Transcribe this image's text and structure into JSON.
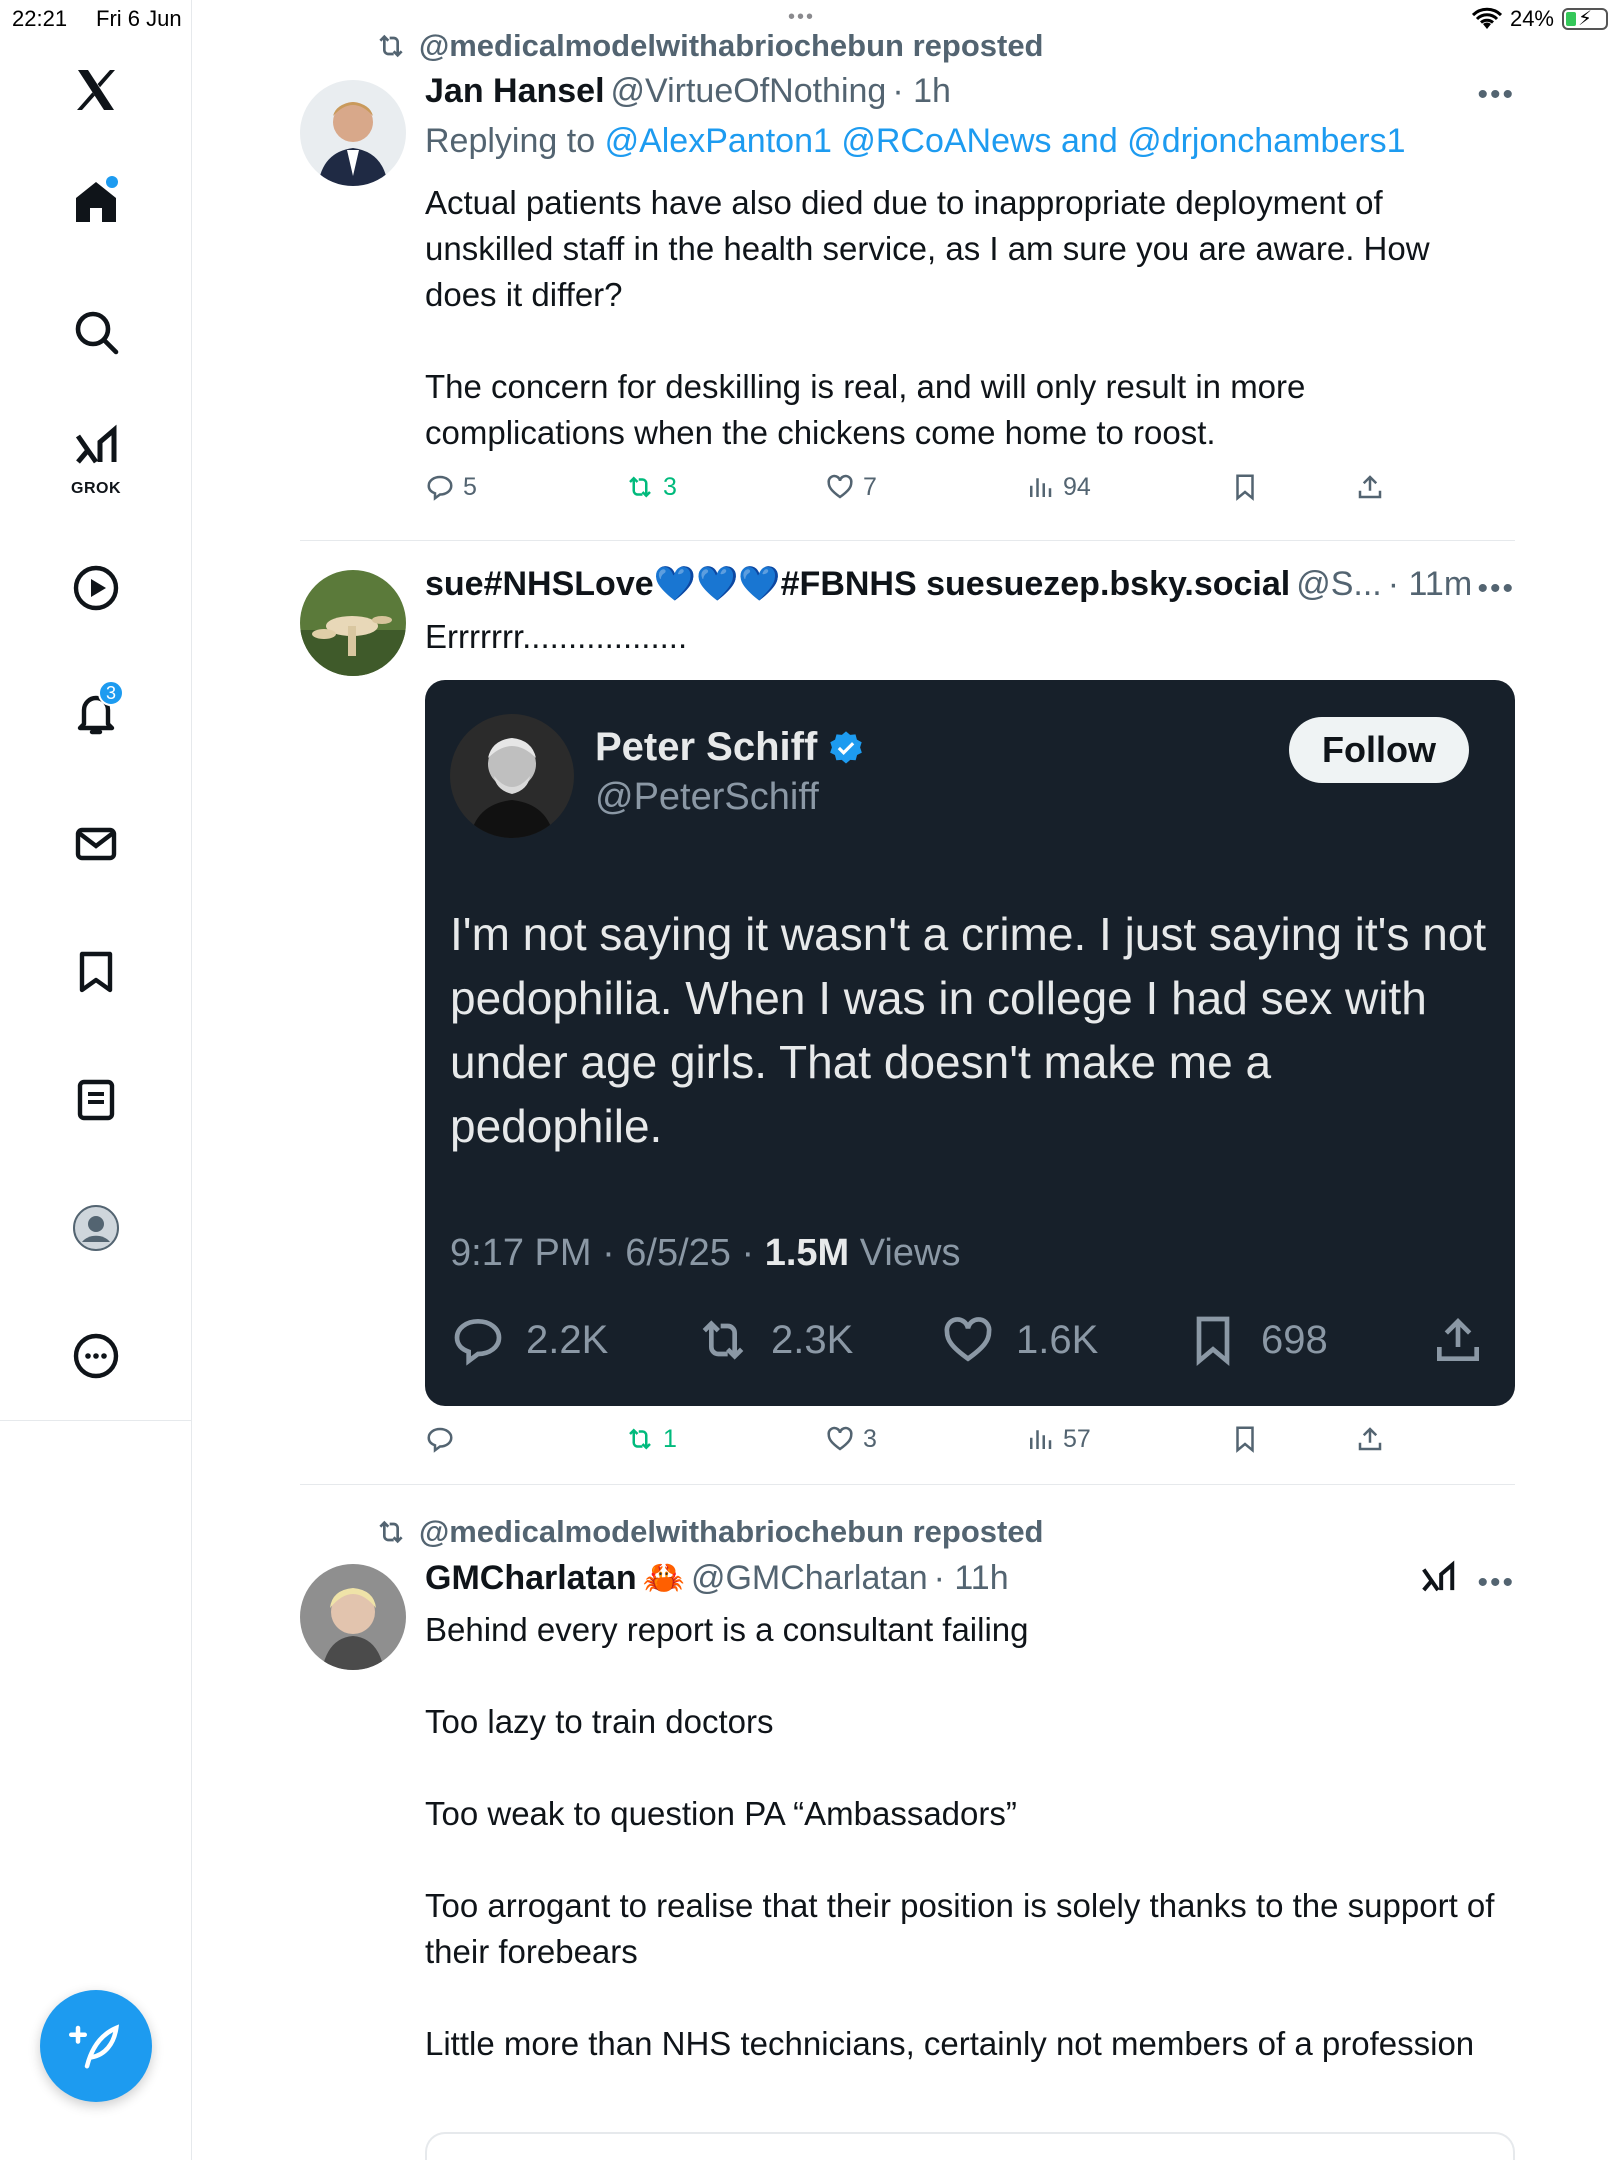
{
  "status_bar": {
    "time": "22:21",
    "date": "Fri 6 Jun",
    "battery": "24%",
    "top_dots": "•••"
  },
  "sidebar": {
    "items": [
      {
        "name": "home",
        "has_dot": true
      },
      {
        "name": "explore"
      },
      {
        "name": "grok",
        "label": "GROK"
      },
      {
        "name": "video"
      },
      {
        "name": "notifications",
        "badge": "3"
      },
      {
        "name": "messages"
      },
      {
        "name": "bookmarks"
      },
      {
        "name": "lists"
      },
      {
        "name": "profile"
      },
      {
        "name": "more"
      }
    ]
  },
  "colors": {
    "accent": "#1d9bf0",
    "repost_green": "#00ba7c",
    "muted": "#536471",
    "embed_bg": "#17202a"
  },
  "posts": [
    {
      "repost_by": "@medicalmodelwithabriochebun reposted",
      "name": "Jan Hansel",
      "handle": "@VirtueOfNothing",
      "time": "· 1h",
      "replying_prefix": "Replying to",
      "replying_to": "@AlexPanton1 @RCoANews and @drjonchambers1",
      "paragraphs": [
        "Actual patients have also died due to inappropriate deployment of unskilled staff in the health service, as I am sure you are aware. How does it differ?",
        "The concern for deskilling is real, and will only result in more complications when the chickens come home to roost."
      ],
      "stats": {
        "replies": "5",
        "reposts": "3",
        "likes": "7",
        "views": "94"
      }
    },
    {
      "name": "sue#NHSLove💙💙💙#FBNHS suesuezep.bsky.social",
      "handle": "@S...",
      "time": "· 11m",
      "text": "Errrrrrr..................",
      "embed": {
        "name": "Peter Schiff",
        "handle": "@PeterSchiff",
        "follow_label": "Follow",
        "text": "I'm not saying it wasn't a crime.  I just saying it's not pedophilia. When I was in college I had sex with under age girls. That doesn't make me a pedophile.",
        "meta_prefix": "9:17 PM · 6/5/25 · ",
        "views_count": "1.5M",
        "views_label": " Views",
        "stats": {
          "replies": "2.2K",
          "reposts": "2.3K",
          "likes": "1.6K",
          "bookmarks": "698"
        }
      },
      "stats": {
        "replies": "",
        "reposts": "1",
        "likes": "3",
        "views": "57"
      }
    },
    {
      "repost_by": "@medicalmodelwithabriochebun reposted",
      "name": "GMCharlatan",
      "emoji": "🦀",
      "handle": "@GMCharlatan",
      "time": "· 11h",
      "paragraphs": [
        "Behind every report is a consultant failing",
        "Too lazy to train doctors",
        "Too weak to question PA “Ambassadors”",
        "Too arrogant to realise that their position is solely thanks to the support of their forebears",
        "Little more than NHS technicians, certainly not members of a profession"
      ]
    }
  ]
}
